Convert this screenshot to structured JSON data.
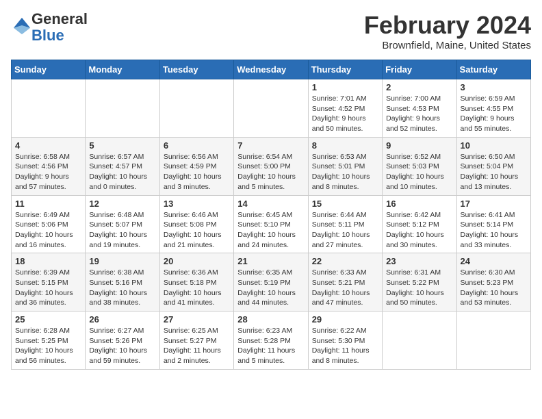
{
  "header": {
    "logo_line1": "General",
    "logo_line2": "Blue",
    "month": "February 2024",
    "location": "Brownfield, Maine, United States"
  },
  "days_of_week": [
    "Sunday",
    "Monday",
    "Tuesday",
    "Wednesday",
    "Thursday",
    "Friday",
    "Saturday"
  ],
  "weeks": [
    [
      {
        "day": "",
        "info": ""
      },
      {
        "day": "",
        "info": ""
      },
      {
        "day": "",
        "info": ""
      },
      {
        "day": "",
        "info": ""
      },
      {
        "day": "1",
        "info": "Sunrise: 7:01 AM\nSunset: 4:52 PM\nDaylight: 9 hours\nand 50 minutes."
      },
      {
        "day": "2",
        "info": "Sunrise: 7:00 AM\nSunset: 4:53 PM\nDaylight: 9 hours\nand 52 minutes."
      },
      {
        "day": "3",
        "info": "Sunrise: 6:59 AM\nSunset: 4:55 PM\nDaylight: 9 hours\nand 55 minutes."
      }
    ],
    [
      {
        "day": "4",
        "info": "Sunrise: 6:58 AM\nSunset: 4:56 PM\nDaylight: 9 hours\nand 57 minutes."
      },
      {
        "day": "5",
        "info": "Sunrise: 6:57 AM\nSunset: 4:57 PM\nDaylight: 10 hours\nand 0 minutes."
      },
      {
        "day": "6",
        "info": "Sunrise: 6:56 AM\nSunset: 4:59 PM\nDaylight: 10 hours\nand 3 minutes."
      },
      {
        "day": "7",
        "info": "Sunrise: 6:54 AM\nSunset: 5:00 PM\nDaylight: 10 hours\nand 5 minutes."
      },
      {
        "day": "8",
        "info": "Sunrise: 6:53 AM\nSunset: 5:01 PM\nDaylight: 10 hours\nand 8 minutes."
      },
      {
        "day": "9",
        "info": "Sunrise: 6:52 AM\nSunset: 5:03 PM\nDaylight: 10 hours\nand 10 minutes."
      },
      {
        "day": "10",
        "info": "Sunrise: 6:50 AM\nSunset: 5:04 PM\nDaylight: 10 hours\nand 13 minutes."
      }
    ],
    [
      {
        "day": "11",
        "info": "Sunrise: 6:49 AM\nSunset: 5:06 PM\nDaylight: 10 hours\nand 16 minutes."
      },
      {
        "day": "12",
        "info": "Sunrise: 6:48 AM\nSunset: 5:07 PM\nDaylight: 10 hours\nand 19 minutes."
      },
      {
        "day": "13",
        "info": "Sunrise: 6:46 AM\nSunset: 5:08 PM\nDaylight: 10 hours\nand 21 minutes."
      },
      {
        "day": "14",
        "info": "Sunrise: 6:45 AM\nSunset: 5:10 PM\nDaylight: 10 hours\nand 24 minutes."
      },
      {
        "day": "15",
        "info": "Sunrise: 6:44 AM\nSunset: 5:11 PM\nDaylight: 10 hours\nand 27 minutes."
      },
      {
        "day": "16",
        "info": "Sunrise: 6:42 AM\nSunset: 5:12 PM\nDaylight: 10 hours\nand 30 minutes."
      },
      {
        "day": "17",
        "info": "Sunrise: 6:41 AM\nSunset: 5:14 PM\nDaylight: 10 hours\nand 33 minutes."
      }
    ],
    [
      {
        "day": "18",
        "info": "Sunrise: 6:39 AM\nSunset: 5:15 PM\nDaylight: 10 hours\nand 36 minutes."
      },
      {
        "day": "19",
        "info": "Sunrise: 6:38 AM\nSunset: 5:16 PM\nDaylight: 10 hours\nand 38 minutes."
      },
      {
        "day": "20",
        "info": "Sunrise: 6:36 AM\nSunset: 5:18 PM\nDaylight: 10 hours\nand 41 minutes."
      },
      {
        "day": "21",
        "info": "Sunrise: 6:35 AM\nSunset: 5:19 PM\nDaylight: 10 hours\nand 44 minutes."
      },
      {
        "day": "22",
        "info": "Sunrise: 6:33 AM\nSunset: 5:21 PM\nDaylight: 10 hours\nand 47 minutes."
      },
      {
        "day": "23",
        "info": "Sunrise: 6:31 AM\nSunset: 5:22 PM\nDaylight: 10 hours\nand 50 minutes."
      },
      {
        "day": "24",
        "info": "Sunrise: 6:30 AM\nSunset: 5:23 PM\nDaylight: 10 hours\nand 53 minutes."
      }
    ],
    [
      {
        "day": "25",
        "info": "Sunrise: 6:28 AM\nSunset: 5:25 PM\nDaylight: 10 hours\nand 56 minutes."
      },
      {
        "day": "26",
        "info": "Sunrise: 6:27 AM\nSunset: 5:26 PM\nDaylight: 10 hours\nand 59 minutes."
      },
      {
        "day": "27",
        "info": "Sunrise: 6:25 AM\nSunset: 5:27 PM\nDaylight: 11 hours\nand 2 minutes."
      },
      {
        "day": "28",
        "info": "Sunrise: 6:23 AM\nSunset: 5:28 PM\nDaylight: 11 hours\nand 5 minutes."
      },
      {
        "day": "29",
        "info": "Sunrise: 6:22 AM\nSunset: 5:30 PM\nDaylight: 11 hours\nand 8 minutes."
      },
      {
        "day": "",
        "info": ""
      },
      {
        "day": "",
        "info": ""
      }
    ]
  ]
}
